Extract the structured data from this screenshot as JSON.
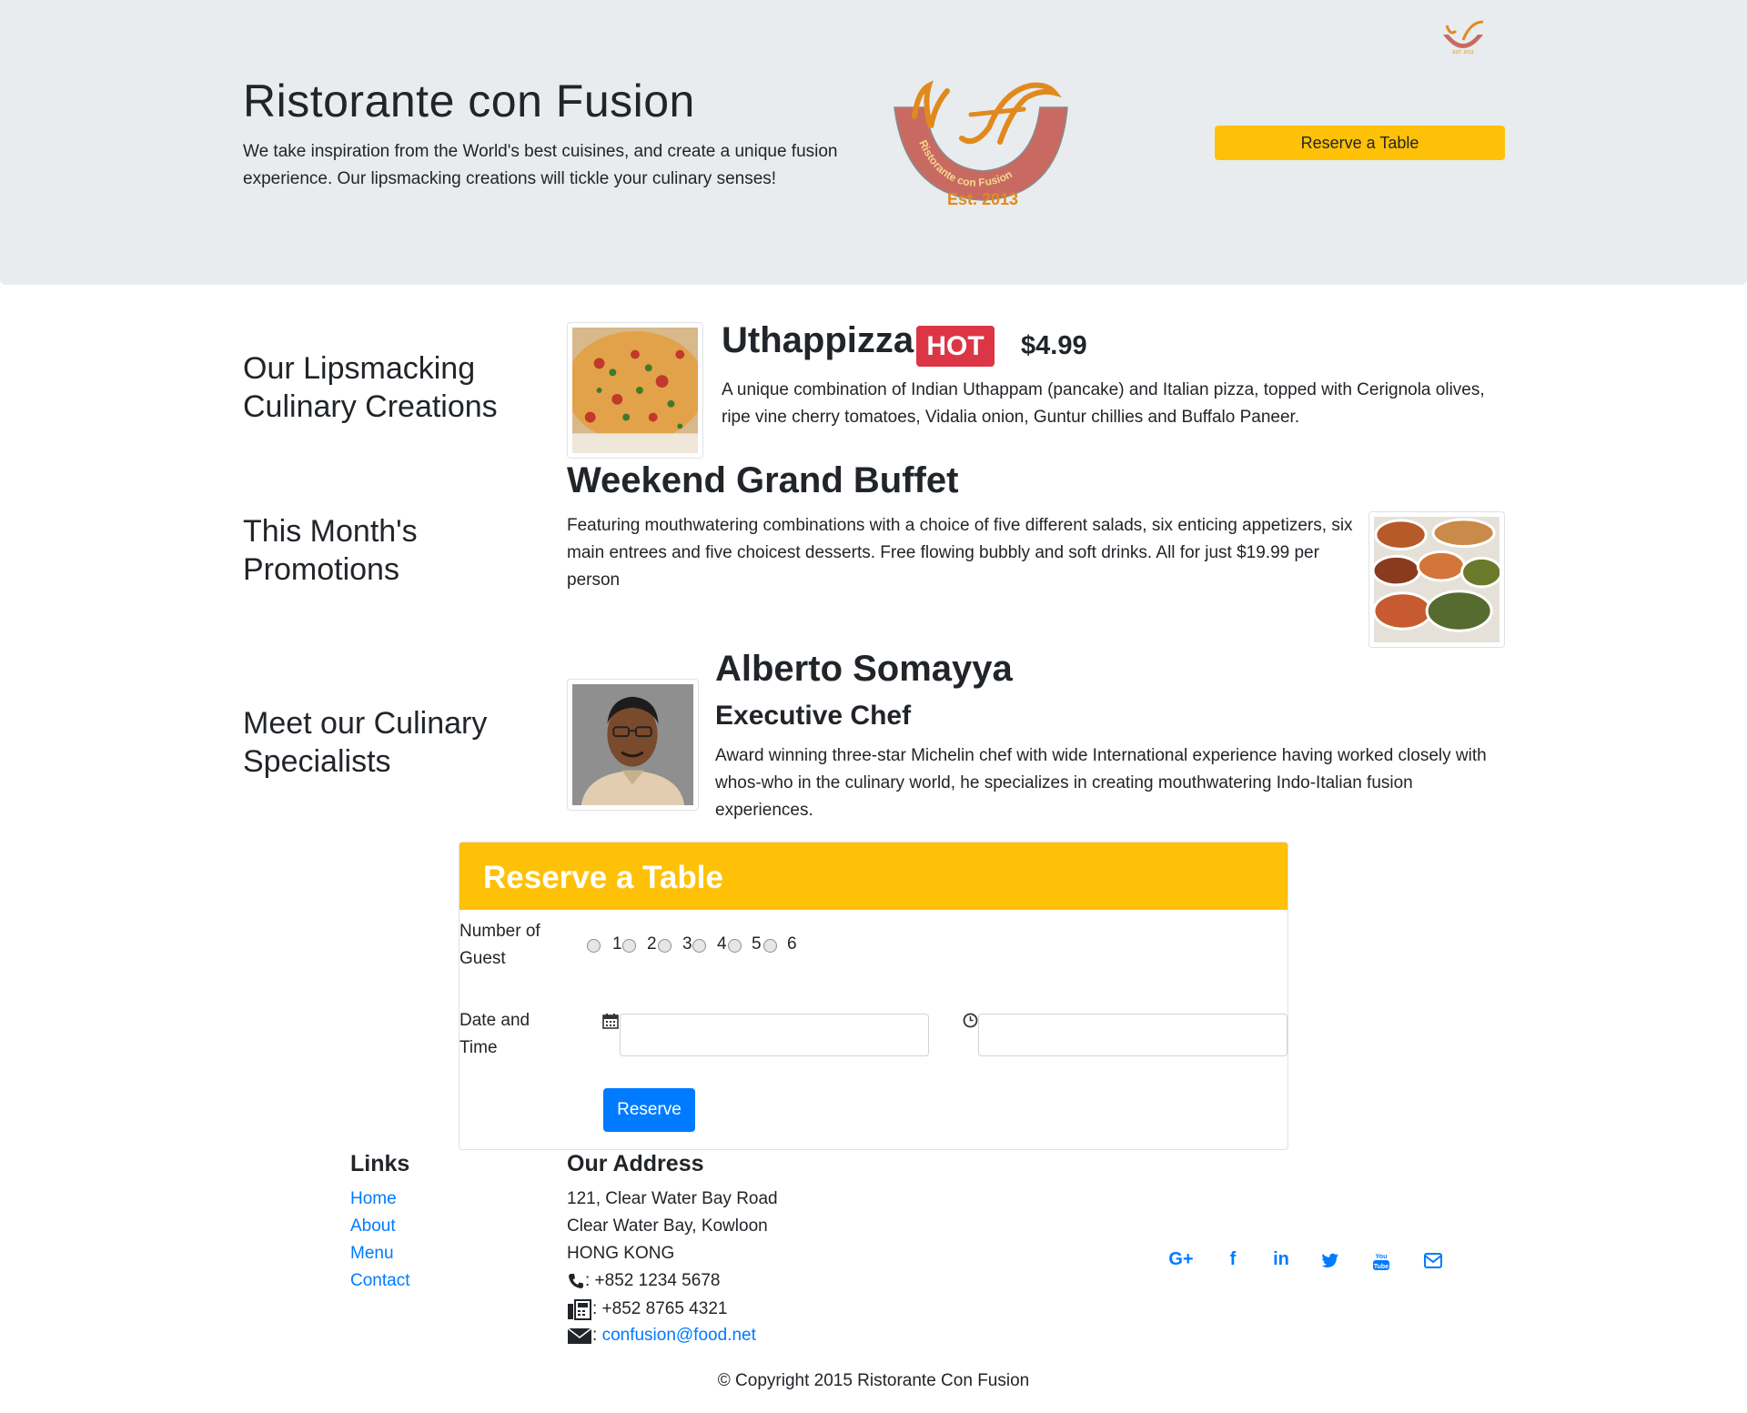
{
  "header": {
    "title": "Ristorante con Fusion",
    "tagline": "We take inspiration from the World's best cuisines, and create a unique fusion experience. Our lipsmacking creations will tickle your culinary senses!",
    "logo_text": "Ristorante con Fusion",
    "logo_est": "Est. 2013",
    "reserve_button": "Reserve a Table"
  },
  "sections": {
    "dish_heading": "Our Lipsmacking Culinary Creations",
    "promo_heading": "This Month's Promotions",
    "chef_heading": "Meet our Culinary Specialists"
  },
  "dish": {
    "name": "Uthappizza",
    "badge": "HOT",
    "price": "$4.99",
    "description": "A unique combination of Indian Uthappam (pancake) and Italian pizza, topped with Cerignola olives, ripe vine cherry tomatoes, Vidalia onion, Guntur chillies and Buffalo Paneer."
  },
  "promotion": {
    "name": "Weekend Grand Buffet",
    "description": "Featuring mouthwatering combinations with a choice of five different salads, six enticing appetizers, six main entrees and five choicest desserts. Free flowing bubbly and soft drinks. All for just $19.99 per person"
  },
  "chef": {
    "name": "Alberto Somayya",
    "title": "Executive Chef",
    "description": "Award winning three-star Michelin chef with wide International experience having worked closely with whos-who in the culinary world, he specializes in creating mouthwatering Indo-Italian fusion experiences."
  },
  "reserve_form": {
    "title": "Reserve a Table",
    "guests_label": "Number of Guest",
    "guest_options": [
      "1",
      "2",
      "3",
      "4",
      "5",
      "6"
    ],
    "date_time_label": "Date and Time",
    "submit": "Reserve"
  },
  "footer": {
    "links_heading": "Links",
    "links": [
      "Home",
      "About",
      "Menu",
      "Contact"
    ],
    "address_heading": "Our Address",
    "address_lines": [
      "121, Clear Water Bay Road",
      "Clear Water Bay, Kowloon",
      "HONG KONG"
    ],
    "phone": ": +852 1234 5678",
    "fax": ": +852 8765 4321",
    "email_prefix": ":",
    "email": "confusion@food.net",
    "social_icons": [
      "google-plus-icon",
      "facebook-icon",
      "linkedin-icon",
      "twitter-icon",
      "youtube-icon",
      "envelope-icon"
    ],
    "copyright": "© Copyright 2015 Ristorante Con Fusion"
  },
  "colors": {
    "accent_yellow": "#ffc107",
    "primary_blue": "#007bff",
    "hot_red": "#dc3545",
    "jumbotron_bg": "#e9ecef"
  }
}
